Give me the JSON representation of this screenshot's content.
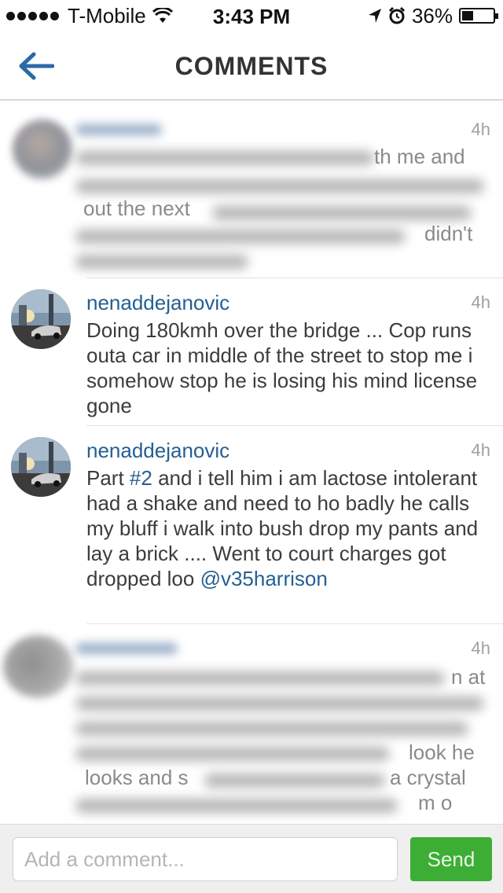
{
  "status_bar": {
    "carrier": "T-Mobile",
    "time": "3:43 PM",
    "battery": "36%"
  },
  "nav": {
    "title": "COMMENTS",
    "back_icon": "arrow-left-icon"
  },
  "comments": [
    {
      "username": "",
      "time": "4h",
      "visible_fragments": [
        "th me and",
        "out the next",
        "didn't"
      ],
      "blurred": true
    },
    {
      "username": "nenaddejanovic",
      "time": "4h",
      "text": "Doing 180kmh over the bridge ... Cop runs outa car in middle of the street to stop me i somehow stop he  is losing his mind license gone",
      "blurred": false
    },
    {
      "username": "nenaddejanovic",
      "time": "4h",
      "text_before": "Part ",
      "hashtag": "#2",
      "text_after": " and i tell him i am lactose intolerant had a shake and need to ho badly he calls my bluff i walk into bush drop my pants and lay a brick .... Went to court charges got dropped loo ",
      "mention": "@v35harrison",
      "blurred": false
    },
    {
      "username": "",
      "time": "4h",
      "visible_fragments": [
        "n at",
        "look he",
        "looks and s",
        "a crystal",
        "m o"
      ],
      "blurred": true
    }
  ],
  "input": {
    "placeholder": "Add a comment...",
    "send_label": "Send"
  },
  "colors": {
    "link": "#255f93",
    "send_button": "#3dae35",
    "timestamp": "#a0a0a0"
  }
}
